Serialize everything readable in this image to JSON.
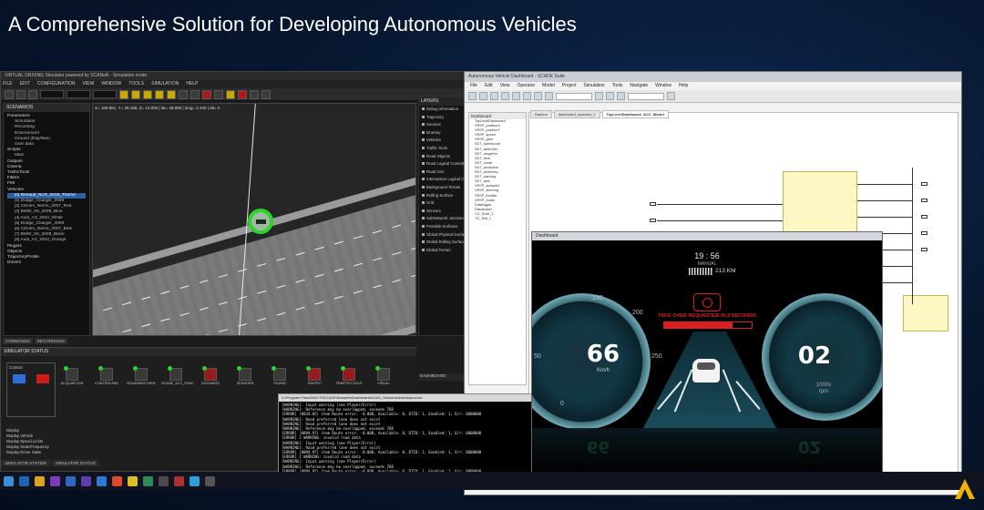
{
  "slide": {
    "title": "A Comprehensive Solution for Developing Autonomous Vehicles"
  },
  "simulator": {
    "window_title": "VIRTUAL DRIVING Simulator powered by SCANeR - Simulation mode",
    "menu": [
      "FILE",
      "EDIT",
      "CONFIGURATION",
      "VIEW",
      "WINDOW",
      "TOOLS",
      "SIMULATION",
      "HELP"
    ],
    "explorer_header": "SCENARIOS",
    "tree": [
      {
        "label": "Parameters",
        "indent": false
      },
      {
        "label": "Simulation",
        "indent": true
      },
      {
        "label": "Recording",
        "indent": true
      },
      {
        "label": "Environment",
        "indent": true
      },
      {
        "label": "Ground (Day/Nite)",
        "indent": true
      },
      {
        "label": "User data",
        "indent": true
      },
      {
        "label": "Scripts",
        "indent": false
      },
      {
        "label": "Main",
        "indent": true
      },
      {
        "label": "Outputs",
        "indent": false
      },
      {
        "label": "Criteria",
        "indent": false
      },
      {
        "label": "TrafficTools",
        "indent": false
      },
      {
        "label": "Filters",
        "indent": false
      },
      {
        "label": "FMI",
        "indent": false
      },
      {
        "label": "Vehicles",
        "indent": false
      },
      {
        "label": "[0] Renault_NUX_2019_Theme",
        "indent": true,
        "selected": true
      },
      {
        "label": "[1] Dodge_Charger_2008",
        "indent": true
      },
      {
        "label": "[2] Citroen_Nemo_2007_Red",
        "indent": true
      },
      {
        "label": "[3] BMW_X5_2008_Blue",
        "indent": true
      },
      {
        "label": "[4] Audi_A3_2010_White",
        "indent": true
      },
      {
        "label": "[5] Dodge_Charger_2008",
        "indent": true
      },
      {
        "label": "[6] Citroen_Nemo_2007_Blue",
        "indent": true
      },
      {
        "label": "[7] BMW_X5_2008_Black",
        "indent": true
      },
      {
        "label": "[8] Audi_A3_2010_Orange",
        "indent": true
      },
      {
        "label": "Plugins",
        "indent": false
      },
      {
        "label": "Objects",
        "indent": false
      },
      {
        "label": "TrajectoryProfile",
        "indent": false
      },
      {
        "label": "Drivers",
        "indent": false
      }
    ],
    "viewport_coords": "X= 106.861, Y= 28.185, Z= 12.000 | lat= 48.869 | long= 2.340 | alt= 0",
    "bottom_view_tabs": [
      "COMMANDS",
      "RECORDINGS"
    ],
    "layers_header": "LAYERS",
    "layers": [
      "Debug information",
      "Trajectory",
      "Sources",
      "Itinerary",
      "Vehicles",
      "Traffic Tools",
      "Road Objects",
      "Road Logical Content",
      "Road Axis",
      "Intersection Logical Content",
      "Background Terrain",
      "Rolling Surface",
      "Grid",
      "Sensors",
      "SubNetwork Junctions",
      "Possible Surfaces",
      "Global Physical Surfaces",
      "Global Rolling Surface",
      "Global Terrain"
    ],
    "dashboard_tab": "DASHBOARD",
    "status_header": "SIMULATOR STATUS",
    "control_label": "Control",
    "modules": [
      {
        "label": "ACQUISITION",
        "red": false
      },
      {
        "label": "CONTROLPAD",
        "red": false
      },
      {
        "label": "ROADSWITCHER",
        "red": false
      },
      {
        "label": "SCADE_ACC_FUNC",
        "red": false
      },
      {
        "label": "SCENARIO",
        "red": true
      },
      {
        "label": "SENSORS",
        "red": false
      },
      {
        "label": "SOUND",
        "red": false
      },
      {
        "label": "TRAFFIC",
        "red": true
      },
      {
        "label": "TRAFFICTOOLS",
        "red": true
      },
      {
        "label": "VISUAL",
        "red": false
      }
    ],
    "display_list": [
      "Display",
      "Display Vehicle",
      "Display Speed Limits",
      "Display State/Frequency",
      "Display Driver State"
    ],
    "bottom_tabs": [
      "SIMULATOR SYSTEM",
      "SIMULATOR STATUS"
    ]
  },
  "engineering": {
    "window_title": "Autonomous Vehicle Dashboard - SCADE Suite",
    "menu": [
      "File",
      "Edit",
      "View",
      "Operator",
      "Model",
      "Project",
      "Simulation",
      "Tools",
      "Navigate",
      "Window",
      "Help"
    ],
    "tree_header": "Dashboard",
    "tree": [
      "TopLevelDashboard",
      "VRSP_positionX",
      "VRSP_positionY",
      "VRSP_speed",
      "VRSP_gear",
      "SDT_speedLimit",
      "SDT_takeOver",
      "SDT_rangeKm",
      "SDT_time",
      "SDT_mode",
      "SDT_accActive",
      "SDT_laneKeep",
      "SDT_warning",
      "SDT_tank",
      "VRSP_autopilot",
      "VRSP_steering",
      "VRSP_throttle",
      "VRSP_brake",
      "Datalogger",
      "Dashboard",
      "CG_Suite_1",
      "TS_Test_1"
    ],
    "doc_tabs": [
      "Dashbo",
      "dashboard_scenario_1",
      "TopLevelDashboard_ACC_Mode1"
    ],
    "doc_active_index": 2
  },
  "dashboard": {
    "window_title": "Dashboard",
    "time": "19 : 56",
    "mode": "MANUAL",
    "range": "213 KM",
    "speed": "66",
    "speed_unit": "Km/h",
    "ticks": [
      "150",
      "200",
      "250",
      "50",
      "0"
    ],
    "takeover_text": "TAKE OVER REQUESTED IN 2 SECONDS",
    "takeover_progress": 0.78,
    "gear": "02",
    "rpm_line1": "1000x",
    "rpm_line2": "rpm"
  },
  "console": {
    "title": "C:\\Program Files\\ANSYS\\SCADE\\Samples\\Dashboard\\ADAS_Scenario\\dashboard.exe",
    "lines": [
      "[WARNING]: Input warning (see Player/Error)",
      "[WARNING]: Reference may be overlapped, exceeds 768",
      "[ERROR] (8034.85) item Route error: -0.008, Available: 0, DTID: 1, Enabled: 1, Err: 0000000",
      "[WARNING]: Road preferred lane does not exist",
      "[WARNING]: Road preferred lane does not exist",
      "[WARNING]: Reference may be overlapped, exceeds 768",
      "[ERROR] (8094.97) item Route error: -0.008, Available: 0, DTID: 1, Enabled: 1, Err: 0000000",
      "[ERROR] 2 WARNING: invalid road data",
      "[WARNING]: Input warning (see Player/Error)",
      "[WARNING]: Road preferred lane does not exist",
      "[ERROR] (8094.97) item Route error: -0.008, Available: 0, DTID: 1, Enabled: 1, Err: 0000000",
      "[ERROR] 2 WARNING: invalid road data",
      "[WARNING]: Input warning (see Player/Error)",
      "[WARNING]: Reference may be overlapped, exceeds 768",
      "[ERROR] (8094.97) item Route error: -0.008, Available: 0, DTID: 1, Enabled: 1, Err: 0000000",
      "[WARNING]: Input warning (see Player/Error)"
    ]
  },
  "colors": {
    "accent_green": "#2fd12f",
    "alert_red": "#d92020",
    "gauge_teal": "#6fa7b3"
  }
}
